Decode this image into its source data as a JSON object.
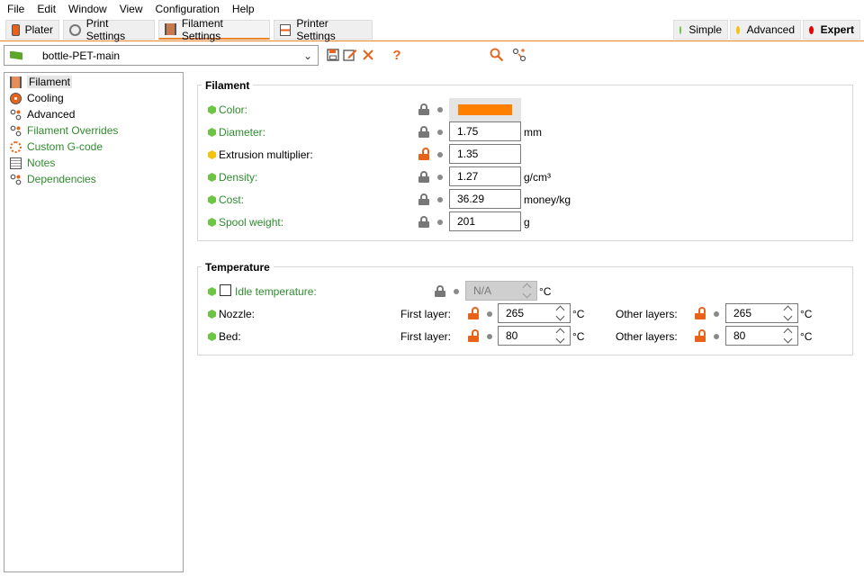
{
  "menu": [
    "File",
    "Edit",
    "Window",
    "View",
    "Configuration",
    "Help"
  ],
  "tabs": [
    {
      "label": "Plater",
      "icon": "plater-icon"
    },
    {
      "label": "Print Settings",
      "icon": "print-settings-icon"
    },
    {
      "label": "Filament Settings",
      "icon": "filament-spool-icon",
      "active": true
    },
    {
      "label": "Printer Settings",
      "icon": "printer-settings-icon"
    }
  ],
  "modes": [
    {
      "label": "Simple",
      "color": "#6cc644"
    },
    {
      "label": "Advanced",
      "color": "#f2c40f"
    },
    {
      "label": "Expert",
      "color": "#e60000",
      "active": true
    }
  ],
  "preset": {
    "name": "bottle-PET-main",
    "flag_color": "#5aa72a"
  },
  "toolbar_icons": [
    "save-icon",
    "rename-icon",
    "delete-icon",
    "help-icon",
    "unlocked-icon",
    "bullet-icon",
    "search-icon",
    "compare-icon"
  ],
  "toolbar_help": "?",
  "sidebar": {
    "items": [
      {
        "label": "Filament",
        "icon": "filament-spool-icon",
        "selected": true
      },
      {
        "label": "Cooling",
        "icon": "fan-icon"
      },
      {
        "label": "Advanced",
        "icon": "wrench-icon"
      },
      {
        "label": "Filament Overrides",
        "icon": "wrench-icon"
      },
      {
        "label": "Custom G-code",
        "icon": "gcode-icon"
      },
      {
        "label": "Notes",
        "icon": "notes-icon"
      },
      {
        "label": "Dependencies",
        "icon": "wrench-icon"
      }
    ]
  },
  "filament_group": {
    "title": "Filament",
    "rows": [
      {
        "label": "Color:",
        "dot": "#6cc644",
        "green": true,
        "swatch": "#ff8000"
      },
      {
        "label": "Diameter:",
        "dot": "#6cc644",
        "green": true,
        "value": "1.75",
        "unit": "mm"
      },
      {
        "label": "Extrusion multiplier:",
        "dot": "#f2c40f",
        "green": false,
        "value": "1.35",
        "unit": "",
        "unlocked": true
      },
      {
        "label": "Density:",
        "dot": "#6cc644",
        "green": true,
        "value": "1.27",
        "unit": "g/cm³"
      },
      {
        "label": "Cost:",
        "dot": "#6cc644",
        "green": true,
        "value": "36.29",
        "unit": "money/kg"
      },
      {
        "label": "Spool weight:",
        "dot": "#6cc644",
        "green": true,
        "value": "201",
        "unit": "g"
      }
    ]
  },
  "temperature_group": {
    "title": "Temperature",
    "idle": {
      "label": "Idle temperature:",
      "value": "N/A",
      "unit": "°C",
      "checked": false
    },
    "nozzle": {
      "label": "Nozzle:",
      "first_label": "First layer:",
      "first_value": "265",
      "other_label": "Other layers:",
      "other_value": "265",
      "unit": "°C"
    },
    "bed": {
      "label": "Bed:",
      "first_label": "First layer:",
      "first_value": "80",
      "other_label": "Other layers:",
      "other_value": "80",
      "unit": "°C"
    }
  }
}
